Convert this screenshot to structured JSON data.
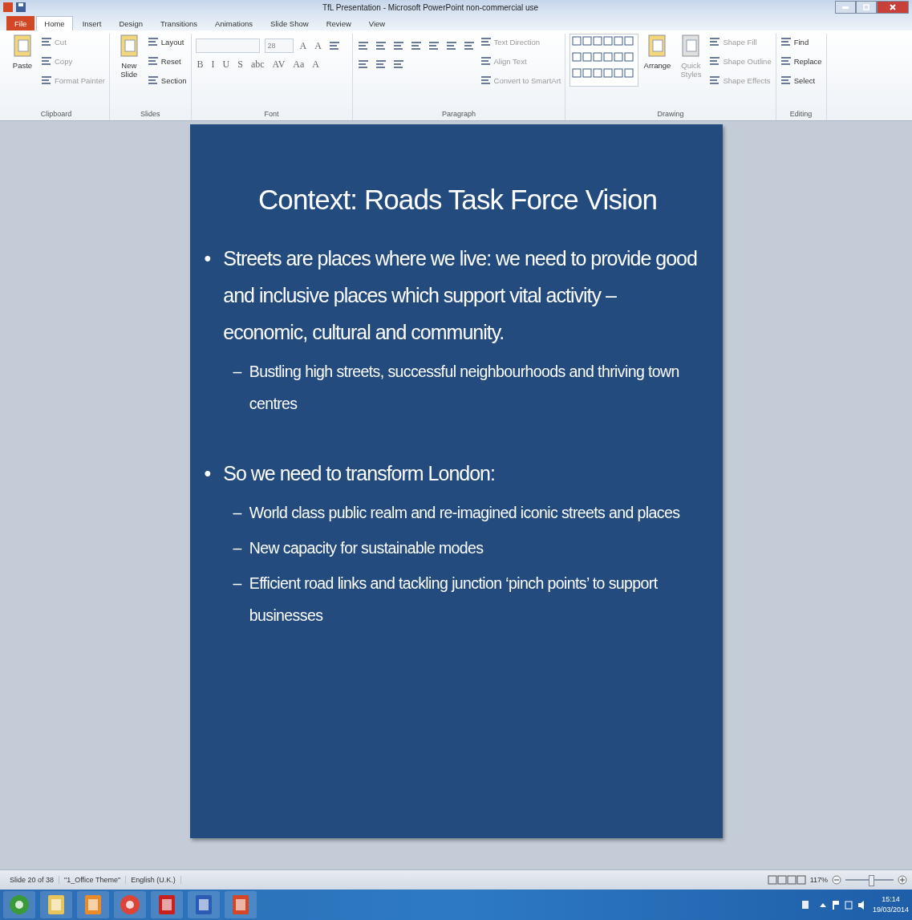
{
  "window": {
    "title": "TfL Presentation - Microsoft PowerPoint non-commercial use"
  },
  "tabs": [
    {
      "label": "File",
      "kind": "file",
      "selected": false
    },
    {
      "label": "Home",
      "kind": "tab",
      "selected": true
    },
    {
      "label": "Insert",
      "kind": "tab",
      "selected": false
    },
    {
      "label": "Design",
      "kind": "tab",
      "selected": false
    },
    {
      "label": "Transitions",
      "kind": "tab",
      "selected": false
    },
    {
      "label": "Animations",
      "kind": "tab",
      "selected": false
    },
    {
      "label": "Slide Show",
      "kind": "tab",
      "selected": false
    },
    {
      "label": "Review",
      "kind": "tab",
      "selected": false
    },
    {
      "label": "View",
      "kind": "tab",
      "selected": false
    }
  ],
  "ribbon": {
    "groups": [
      {
        "label": "Clipboard",
        "large": [
          {
            "label": "Paste",
            "disabled": false
          }
        ],
        "items": [
          {
            "label": "Cut",
            "disabled": true
          },
          {
            "label": "Copy",
            "disabled": true
          },
          {
            "label": "Format Painter",
            "disabled": true
          }
        ]
      },
      {
        "label": "Slides",
        "large": [
          {
            "label": "New Slide",
            "disabled": false
          }
        ],
        "items": [
          {
            "label": "Layout",
            "disabled": false
          },
          {
            "label": "Reset",
            "disabled": false
          },
          {
            "label": "Section",
            "disabled": false
          }
        ]
      },
      {
        "label": "Font",
        "tools": [
          {
            "kind": "field"
          },
          {
            "kind": "field",
            "value": "28"
          },
          {
            "kind": "glyph",
            "label": "A"
          },
          {
            "kind": "glyph",
            "label": "A"
          },
          {
            "kind": "icon"
          },
          {
            "kind": "glyph",
            "label": "B"
          },
          {
            "kind": "glyph",
            "label": "I"
          },
          {
            "kind": "glyph",
            "label": "U"
          },
          {
            "kind": "glyph",
            "label": "S"
          },
          {
            "kind": "glyph",
            "label": "abc"
          },
          {
            "kind": "glyph",
            "label": "AV"
          },
          {
            "kind": "glyph",
            "label": "Aa"
          },
          {
            "kind": "glyph",
            "label": "A"
          }
        ]
      },
      {
        "label": "Paragraph",
        "tools": [
          {
            "kind": "icon"
          },
          {
            "kind": "icon"
          },
          {
            "kind": "icon"
          },
          {
            "kind": "icon"
          },
          {
            "kind": "icon"
          },
          {
            "kind": "icon"
          },
          {
            "kind": "icon"
          },
          {
            "kind": "icon"
          },
          {
            "kind": "icon"
          },
          {
            "kind": "icon"
          }
        ],
        "items": [
          {
            "label": "Text Direction",
            "disabled": true
          },
          {
            "label": "Align Text",
            "disabled": true
          },
          {
            "label": "Convert to SmartArt",
            "disabled": true
          }
        ]
      },
      {
        "label": "Drawing",
        "large": [
          {
            "kind": "gallery"
          },
          {
            "label": "Arrange",
            "disabled": false
          },
          {
            "label": "Quick Styles",
            "disabled": true
          }
        ],
        "items": [
          {
            "label": "Shape Fill",
            "disabled": true
          },
          {
            "label": "Shape Outline",
            "disabled": true
          },
          {
            "label": "Shape Effects",
            "disabled": true
          }
        ]
      },
      {
        "label": "Editing",
        "items": [
          {
            "label": "Find",
            "disabled": false
          },
          {
            "label": "Replace",
            "disabled": false
          },
          {
            "label": "Select",
            "disabled": false
          }
        ]
      }
    ]
  },
  "slide": {
    "title": "Context: Roads Task Force Vision",
    "bullets": [
      {
        "marker": "•",
        "text": "Streets are places where we live: we need to provide good and inclusive places which support vital activity – economic, cultural and community.",
        "children": [
          {
            "marker": "–",
            "text": "Bustling high streets, successful neighbourhoods and thriving town centres"
          }
        ]
      },
      {
        "marker": "•",
        "text": "So we need to transform London:",
        "children": [
          {
            "marker": "–",
            "text": "World class public realm and re-imagined iconic streets and places"
          },
          {
            "marker": "–",
            "text": "New capacity for sustainable modes"
          },
          {
            "marker": "–",
            "text": "Efficient road links and tackling junction ‘pinch points’ to support businesses"
          }
        ]
      }
    ]
  },
  "status_bar": {
    "items": [
      "Slide 20 of 38",
      "\"1_Office Theme\"",
      "English (U.K.)"
    ],
    "zoom": "117%",
    "zoom_slider": {
      "level": 0.54
    }
  },
  "taskbar": {
    "apps": [
      {
        "kind": "start"
      },
      {
        "kind": "folder"
      },
      {
        "kind": "media"
      },
      {
        "kind": "browser"
      },
      {
        "kind": "pdf"
      },
      {
        "kind": "word"
      },
      {
        "kind": "powerpoint"
      }
    ],
    "time": "15:14",
    "date": "19/03/2014"
  }
}
